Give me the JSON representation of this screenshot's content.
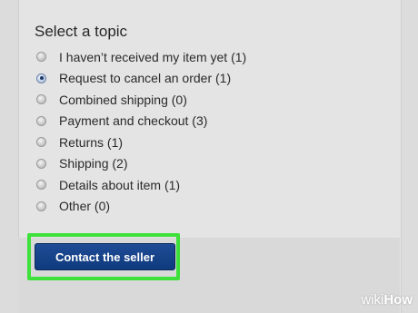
{
  "topic_form": {
    "heading": "Select a topic",
    "options": [
      {
        "label": "I haven’t received my item yet (1)",
        "selected": false
      },
      {
        "label": "Request to cancel an order (1)",
        "selected": true
      },
      {
        "label": "Combined shipping (0)",
        "selected": false
      },
      {
        "label": "Payment and checkout (3)",
        "selected": false
      },
      {
        "label": "Returns (1)",
        "selected": false
      },
      {
        "label": "Shipping (2)",
        "selected": false
      },
      {
        "label": "Details about item (1)",
        "selected": false
      },
      {
        "label": "Other (0)",
        "selected": false
      }
    ],
    "contact_button_label": "Contact the seller"
  },
  "watermark": {
    "part1": "wiki",
    "part2": "How"
  },
  "colors": {
    "button_blue": "#0f3a7e",
    "highlight_green": "#3ee03a"
  }
}
